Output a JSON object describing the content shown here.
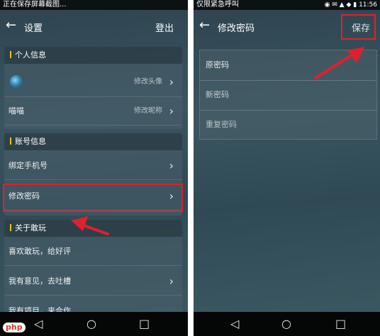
{
  "left": {
    "statusbar_text": "正在保存屏幕截图...",
    "title": "设置",
    "action": "登出",
    "sections": {
      "personal": "个人信息",
      "account": "账号信息",
      "about": "关于敢玩"
    },
    "rows": {
      "avatar_hint": "修改头像",
      "nickname": "喵喵",
      "nickname_hint": "修改昵称",
      "bind_phone": "绑定手机号",
      "change_password": "修改密码",
      "rate": "喜欢敢玩，给好评",
      "feedback": "我有意见，去吐槽",
      "cooperate": "我有项目，来合作"
    }
  },
  "right": {
    "statusbar_text": "仅限紧急呼叫",
    "time": "11:56",
    "title": "修改密码",
    "action": "保存",
    "fields": {
      "old_password": "原密码",
      "new_password": "新密码",
      "repeat_password": "重复密码"
    }
  },
  "watermark": "php",
  "colors": {
    "highlight": "#e0202c",
    "section_bar": "#f2c200"
  }
}
